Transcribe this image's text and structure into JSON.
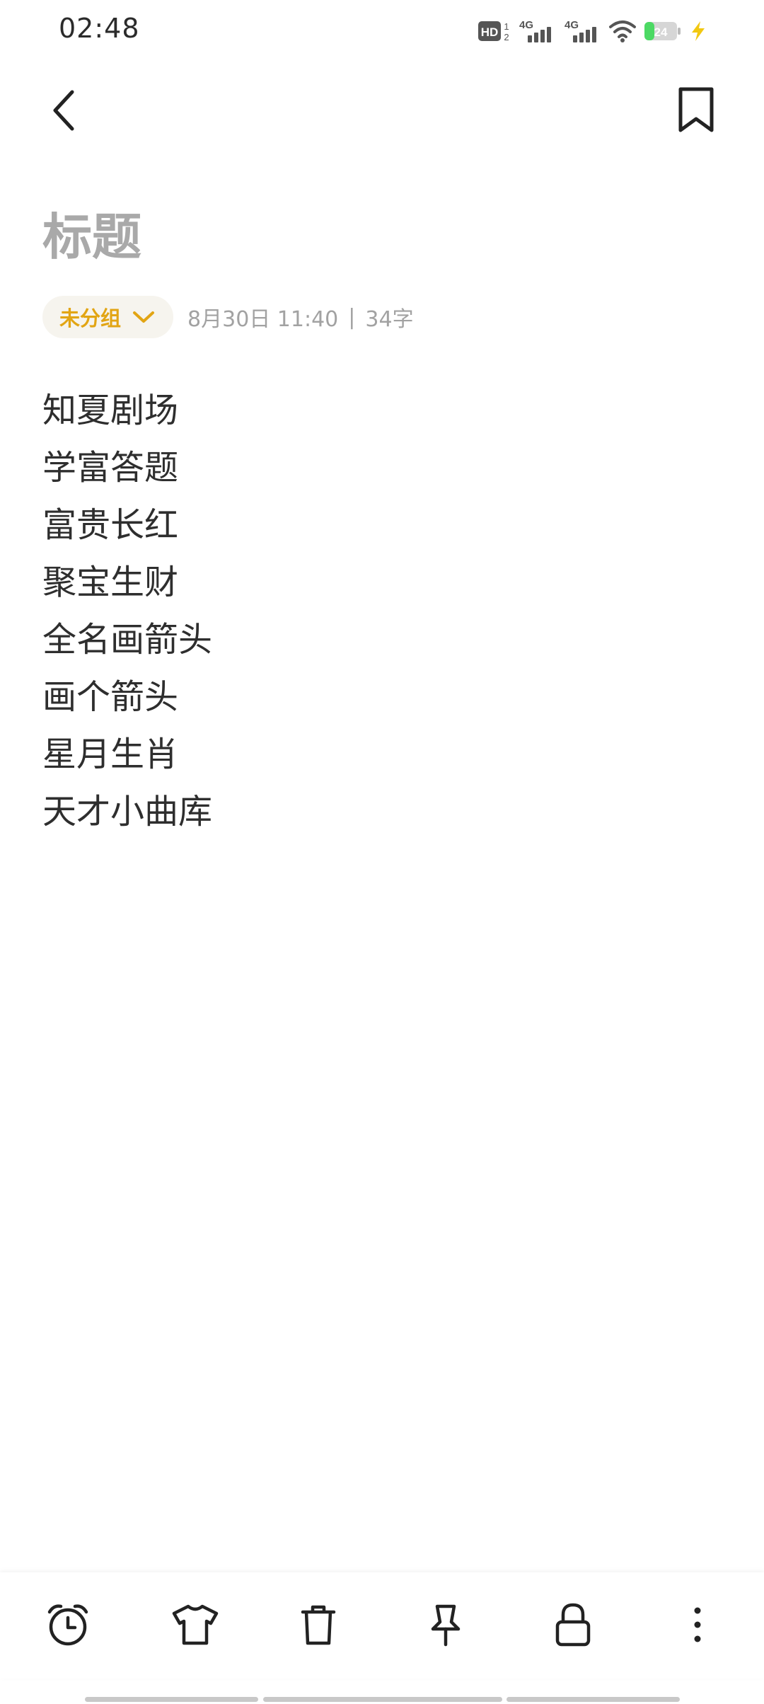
{
  "status_bar": {
    "time": "02:48",
    "hd_label": "HD",
    "hd_sub": "1\n2",
    "net1": "4G",
    "net2": "4G",
    "battery": "24",
    "icons": [
      "hd-icon",
      "signal-4g-icon",
      "signal-4g-icon",
      "wifi-icon",
      "battery-icon",
      "charging-icon"
    ]
  },
  "nav": {
    "back_icon": "back-arrow-icon",
    "bookmark_icon": "bookmark-icon"
  },
  "note": {
    "title_placeholder": "标题",
    "group": "未分组",
    "date": "8月30日 11:40",
    "separator": "|",
    "word_count": "34字",
    "lines": [
      "知夏剧场",
      "学富答题",
      "富贵长红",
      "聚宝生财",
      "全名画箭头",
      "画个箭头",
      "星月生肖",
      "天才小曲库"
    ]
  },
  "toolbar": {
    "items": [
      "alarm-icon",
      "theme-shirt-icon",
      "trash-icon",
      "pin-icon",
      "lock-icon",
      "more-icon"
    ]
  },
  "colors": {
    "accent": "#e2a514",
    "title_gray": "#a9a9a9",
    "meta_gray": "#a2a2a2",
    "battery_green": "#4cd964",
    "charge_yellow": "#f2c811"
  }
}
